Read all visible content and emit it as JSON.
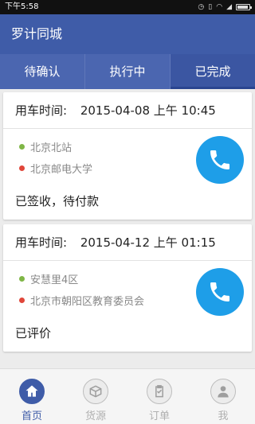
{
  "status_bar": {
    "time": "下午5:58",
    "icons": [
      "alarm-icon",
      "vibrate-icon",
      "wifi-icon",
      "signal-icon",
      "battery-icon"
    ],
    "battery_level": 0.8
  },
  "app": {
    "title": "罗计同城"
  },
  "tabs": [
    {
      "label": "待确认",
      "active": false
    },
    {
      "label": "执行中",
      "active": false
    },
    {
      "label": "已完成",
      "active": true
    }
  ],
  "orders": [
    {
      "time_label": "用车时间:",
      "time_value": "2015-04-08 上午 10:45",
      "from": "北京北站",
      "to": "北京邮电大学",
      "status": "已签收，待付款"
    },
    {
      "time_label": "用车时间:",
      "time_value": "2015-04-12 上午 01:15",
      "from": "安慧里4区",
      "to": "北京市朝阳区教育委员会",
      "status": "已评价"
    }
  ],
  "bottom_nav": [
    {
      "label": "首页",
      "icon": "home-icon",
      "active": true
    },
    {
      "label": "货源",
      "icon": "box-icon",
      "active": false
    },
    {
      "label": "订单",
      "icon": "clipboard-icon",
      "active": false
    },
    {
      "label": "我",
      "icon": "person-icon",
      "active": false
    }
  ],
  "colors": {
    "primary": "#3f5ca8",
    "tab_bg": "#4b66b0",
    "call_button": "#1e9ee8",
    "origin_dot": "#7fb646",
    "destination_dot": "#e0463a"
  }
}
